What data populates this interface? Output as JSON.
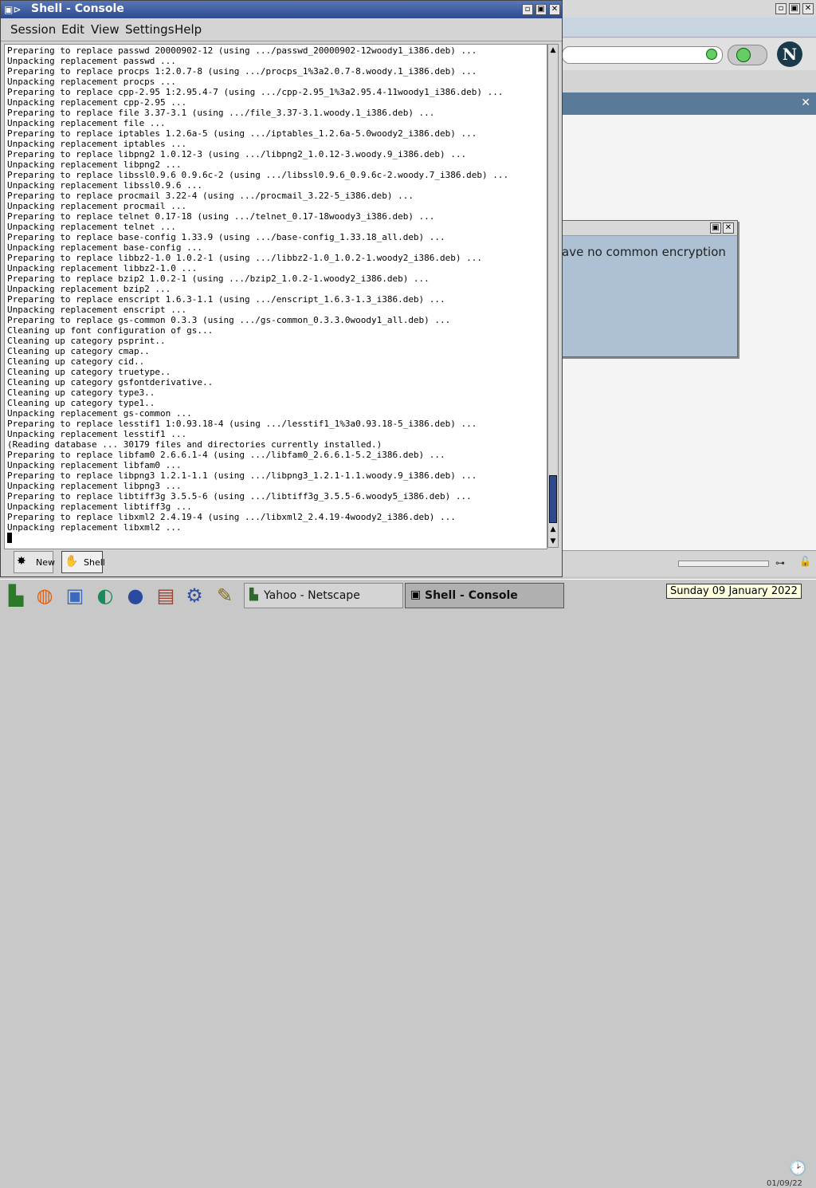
{
  "netscape": {
    "url_value": "",
    "logo_letter": "N",
    "sidebar_close": "✕"
  },
  "dialog": {
    "text": "ave no common encryption"
  },
  "console": {
    "title": "Shell - Console",
    "menu": [
      "Session",
      "Edit",
      "View",
      "Settings",
      "Help"
    ],
    "lines": [
      "Preparing to replace passwd 20000902-12 (using .../passwd_20000902-12woody1_i386.deb) ...",
      "Unpacking replacement passwd ...",
      "Preparing to replace procps 1:2.0.7-8 (using .../procps_1%3a2.0.7-8.woody.1_i386.deb) ...",
      "Unpacking replacement procps ...",
      "Preparing to replace cpp-2.95 1:2.95.4-7 (using .../cpp-2.95_1%3a2.95.4-11woody1_i386.deb) ...",
      "Unpacking replacement cpp-2.95 ...",
      "Preparing to replace file 3.37-3.1 (using .../file_3.37-3.1.woody.1_i386.deb) ...",
      "Unpacking replacement file ...",
      "Preparing to replace iptables 1.2.6a-5 (using .../iptables_1.2.6a-5.0woody2_i386.deb) ...",
      "Unpacking replacement iptables ...",
      "Preparing to replace libpng2 1.0.12-3 (using .../libpng2_1.0.12-3.woody.9_i386.deb) ...",
      "Unpacking replacement libpng2 ...",
      "Preparing to replace libssl0.9.6 0.9.6c-2 (using .../libssl0.9.6_0.9.6c-2.woody.7_i386.deb) ...",
      "Unpacking replacement libssl0.9.6 ...",
      "Preparing to replace procmail 3.22-4 (using .../procmail_3.22-5_i386.deb) ...",
      "Unpacking replacement procmail ...",
      "Preparing to replace telnet 0.17-18 (using .../telnet_0.17-18woody3_i386.deb) ...",
      "Unpacking replacement telnet ...",
      "Preparing to replace base-config 1.33.9 (using .../base-config_1.33.18_all.deb) ...",
      "Unpacking replacement base-config ...",
      "Preparing to replace libbz2-1.0 1.0.2-1 (using .../libbz2-1.0_1.0.2-1.woody2_i386.deb) ...",
      "Unpacking replacement libbz2-1.0 ...",
      "Preparing to replace bzip2 1.0.2-1 (using .../bzip2_1.0.2-1.woody2_i386.deb) ...",
      "Unpacking replacement bzip2 ...",
      "Preparing to replace enscript 1.6.3-1.1 (using .../enscript_1.6.3-1.3_i386.deb) ...",
      "Unpacking replacement enscript ...",
      "Preparing to replace gs-common 0.3.3 (using .../gs-common_0.3.3.0woody1_all.deb) ...",
      "Cleaning up font configuration of gs...",
      "Cleaning up category psprint..",
      "Cleaning up category cmap..",
      "Cleaning up category cid..",
      "Cleaning up category truetype..",
      "Cleaning up category gsfontderivative..",
      "Cleaning up category type3..",
      "Cleaning up category type1..",
      "Unpacking replacement gs-common ...",
      "Preparing to replace lesstif1 1:0.93.18-4 (using .../lesstif1_1%3a0.93.18-5_i386.deb) ...",
      "Unpacking replacement lesstif1 ...",
      "(Reading database ... 30179 files and directories currently installed.)",
      "Preparing to replace libfam0 2.6.6.1-4 (using .../libfam0_2.6.6.1-5.2_i386.deb) ...",
      "Unpacking replacement libfam0 ...",
      "Preparing to replace libpng3 1.2.1-1.1 (using .../libpng3_1.2.1-1.1.woody.9_i386.deb) ...",
      "Unpacking replacement libpng3 ...",
      "Preparing to replace libtiff3g 3.5.5-6 (using .../libtiff3g_3.5.5-6.woody5_i386.deb) ...",
      "Unpacking replacement libtiff3g ...",
      "Preparing to replace libxml2 2.4.19-4 (using .../libxml2_2.4.19-4woody2_i386.deb) ...",
      "Unpacking replacement libxml2 ..."
    ],
    "tabs": [
      {
        "label": "New",
        "icon": "new-session-icon"
      },
      {
        "label": "Shell",
        "icon": "shell-icon"
      }
    ]
  },
  "taskbar": {
    "launchers": [
      "kde-menu-icon",
      "lifebuoy-help-icon",
      "cube-icon",
      "runner-icon",
      "globe-icon",
      "printer-icon",
      "konqueror-icon",
      "text-editor-icon"
    ],
    "tasks": [
      {
        "label": "Yahoo - Netscape",
        "icon": "netscape-icon"
      },
      {
        "label": "Shell - Console",
        "icon": "console-icon"
      }
    ],
    "tooltip": "Sunday 09 January 2022",
    "clock_date": "01/09/22"
  }
}
